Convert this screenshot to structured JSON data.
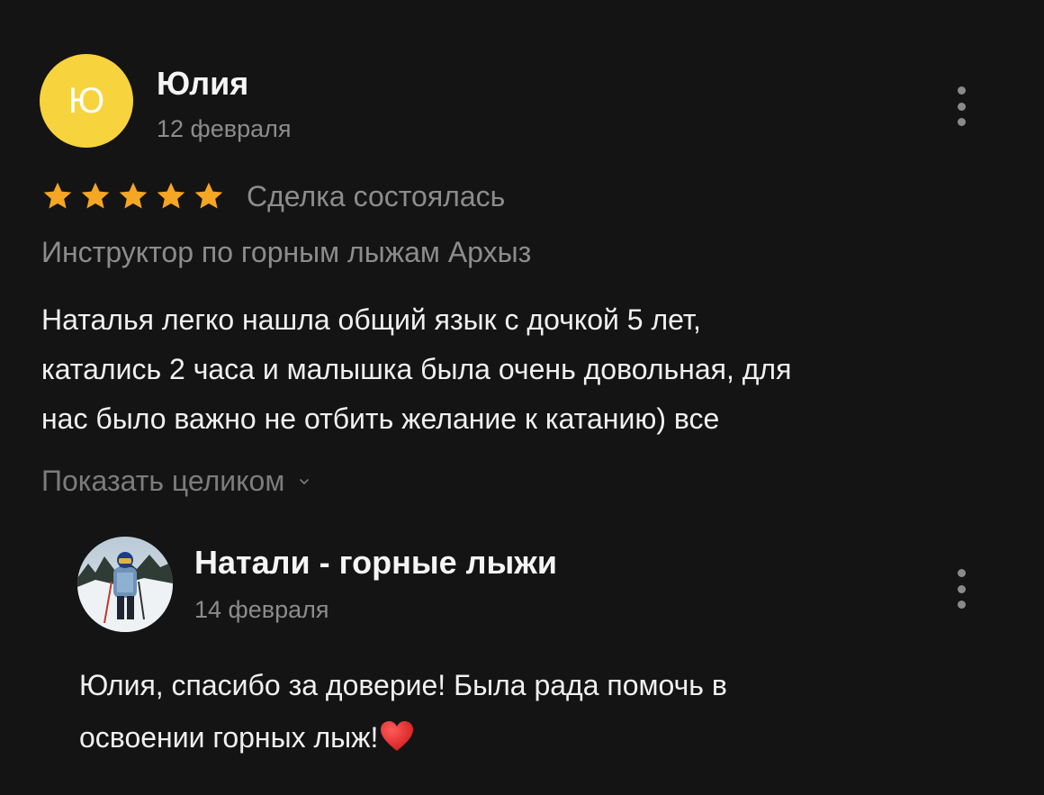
{
  "review": {
    "author": {
      "initial": "Ю",
      "name": "Юлия",
      "date": "12 февраля",
      "avatar_color": "#f7d33d"
    },
    "rating": 5,
    "rating_max": 5,
    "star_color": "#f5a623",
    "deal_status": "Сделка состоялась",
    "service": "Инструктор по горным лыжам Архыз",
    "text_lines": [
      "Наталья легко нашла общий язык с дочкой 5 лет,",
      "катались 2 часа и малышка была очень довольная, для",
      "нас было важно не отбить желание к катанию) все"
    ],
    "show_full_label": "Показать целиком",
    "more_icon": "more-vertical-icon"
  },
  "reply": {
    "name": "Натали - горные лыжи",
    "date": "14 февраля",
    "text_lines": [
      "Юлия, спасибо за доверие! Была рада помочь в",
      "освоении горных лыж!"
    ],
    "emoji": "heart-icon",
    "more_icon": "more-vertical-icon"
  }
}
